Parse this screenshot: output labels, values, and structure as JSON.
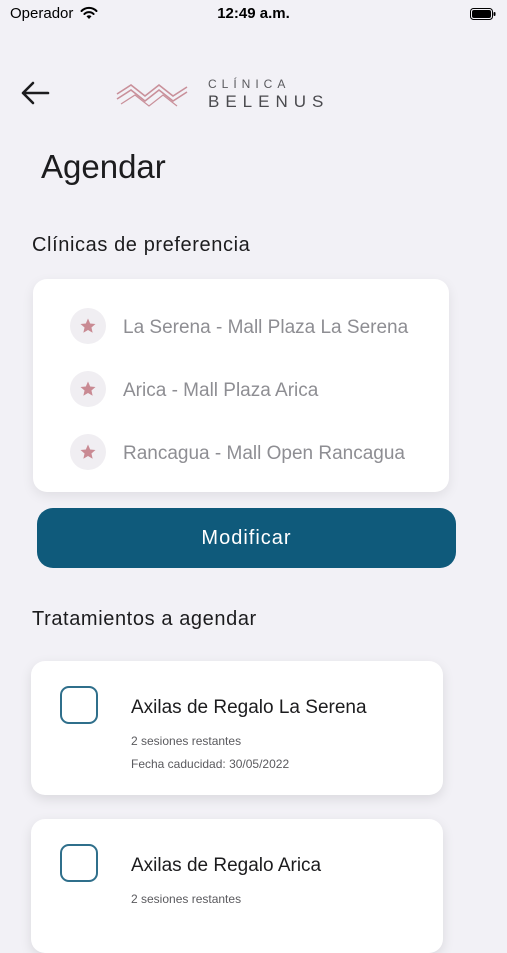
{
  "status_bar": {
    "carrier": "Operador",
    "time": "12:49 a.m."
  },
  "header": {
    "logo_top": "CLÍNICA",
    "logo_main": "BELENUS"
  },
  "page": {
    "title": "Agendar"
  },
  "clinics": {
    "section_title": "Clínicas de preferencia",
    "items": [
      {
        "name": "La Serena - Mall Plaza La Serena"
      },
      {
        "name": "Arica - Mall Plaza Arica"
      },
      {
        "name": "Rancagua - Mall Open Rancagua"
      }
    ],
    "modify_label": "Modificar"
  },
  "treatments": {
    "section_title": "Tratamientos a agendar",
    "items": [
      {
        "name": "Axilas de Regalo La Serena",
        "sessions": "2 sesiones restantes",
        "expiry": "Fecha caducidad: 30/05/2022"
      },
      {
        "name": "Axilas de Regalo Arica",
        "sessions": "2 sesiones restantes",
        "expiry": ""
      }
    ]
  },
  "colors": {
    "accent": "#0f5a7b",
    "star": "#c98a93",
    "background": "#f2f1f6"
  }
}
